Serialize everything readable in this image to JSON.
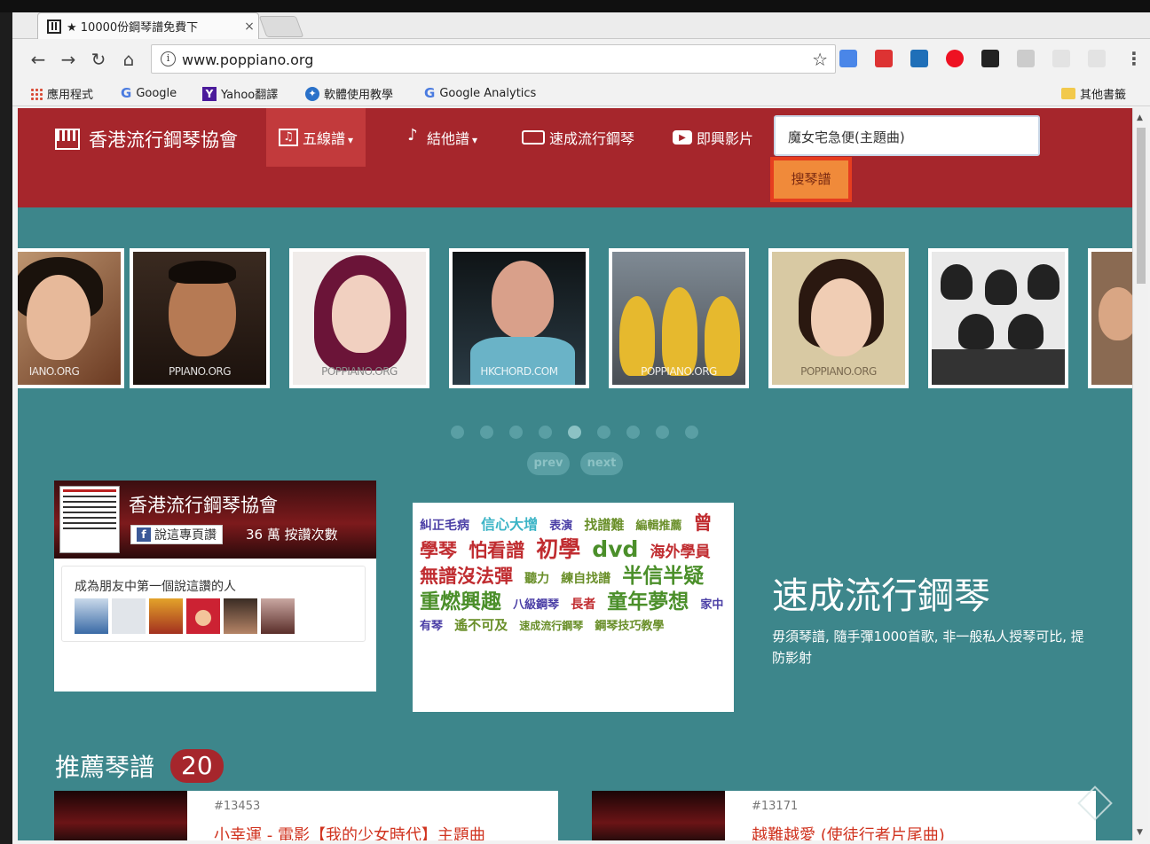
{
  "browser": {
    "tab_title": "★ 10000份鋼琴譜免費下",
    "tab_close": "×",
    "url": "www.poppiano.org",
    "info_icon": "i",
    "star_icon": "☆",
    "menu_icon": "⋮",
    "bookmarks": [
      "應用程式",
      "Google",
      "Yahoo翻譯",
      "軟體使用教學",
      "Google Analytics",
      "其他書籤"
    ]
  },
  "nav": {
    "brand": "香港流行鋼琴協會",
    "items": [
      {
        "label": "五線譜",
        "icon": "music-note-icon"
      },
      {
        "label": "結他譜",
        "icon": "guitar-icon"
      },
      {
        "label": "速成流行鋼琴",
        "icon": "keyboard-icon"
      },
      {
        "label": "即興影片",
        "icon": "video-icon"
      }
    ],
    "search_value": "魔女宅急便(主題曲)",
    "search_button": "搜琴譜"
  },
  "carousel": {
    "watermarks": [
      "IANO.ORG",
      "PPIANO.ORG",
      "POPPIANO.ORG",
      "HKCHORD.COM",
      "POPPIANO.ORG",
      "",
      "POPPIANO.ORG",
      "",
      ""
    ],
    "dot_count": 9,
    "active_dot": 4,
    "prev": "prev",
    "next": "next"
  },
  "fb": {
    "page_name": "香港流行鋼琴協會",
    "like_button": "說這專頁讚",
    "likes": "36 萬 按讚次數",
    "friends_label": "成為朋友中第一個說這讚的人"
  },
  "tags": [
    {
      "text": "糾正毛病",
      "color": "#4b3fa6",
      "size": 14
    },
    {
      "text": "信心大增",
      "color": "#3bb4c6",
      "size": 16
    },
    {
      "text": "表演",
      "color": "#4b3fa6",
      "size": 13
    },
    {
      "text": "找譜難",
      "color": "#6a8f2a",
      "size": 15
    },
    {
      "text": "編輯推薦",
      "color": "#6a8f2a",
      "size": 13
    },
    {
      "text": "曾學琴",
      "color": "#c02c30",
      "size": 21
    },
    {
      "text": "怕看譜",
      "color": "#c02c30",
      "size": 21
    },
    {
      "text": "初學",
      "color": "#c02c30",
      "size": 25
    },
    {
      "text": "dvd",
      "color": "#4b8f2a",
      "size": 25
    },
    {
      "text": "海外學員",
      "color": "#c02c30",
      "size": 17
    },
    {
      "text": "無譜沒法彈",
      "color": "#c02c30",
      "size": 21
    },
    {
      "text": "聽力",
      "color": "#6a8f2a",
      "size": 14
    },
    {
      "text": "練自找譜",
      "color": "#6a8f2a",
      "size": 14
    },
    {
      "text": "半信半疑",
      "color": "#4b8f2a",
      "size": 23
    },
    {
      "text": "重燃興趣",
      "color": "#4b8f2a",
      "size": 23
    },
    {
      "text": "八級鋼琴",
      "color": "#4b3fa6",
      "size": 13
    },
    {
      "text": "長者",
      "color": "#c02c30",
      "size": 14
    },
    {
      "text": "童年夢想",
      "color": "#4b8f2a",
      "size": 23
    },
    {
      "text": "家中有琴",
      "color": "#4b3fa6",
      "size": 13
    },
    {
      "text": "遙不可及",
      "color": "#6a8f2a",
      "size": 15
    },
    {
      "text": "速成流行鋼琴",
      "color": "#6a8f2a",
      "size": 12
    },
    {
      "text": "鋼琴技巧教學",
      "color": "#6a8f2a",
      "size": 13
    }
  ],
  "promo": {
    "title": "速成流行鋼琴",
    "text": "毋須琴譜, 隨手彈1000首歌, 非一般私人授琴可比, 提防影射"
  },
  "recommended": {
    "title": "推薦琴譜",
    "count": "20",
    "cards": [
      {
        "num": "#13453",
        "title": "小幸運 - 電影【我的少女時代】主題曲"
      },
      {
        "num": "#13171",
        "title": "越難越愛 (使徒行者片尾曲)"
      }
    ]
  },
  "colors": {
    "nav_bg": "#a6262c",
    "page_bg": "#3d868b",
    "search_button_bg": "#f08a3a"
  }
}
